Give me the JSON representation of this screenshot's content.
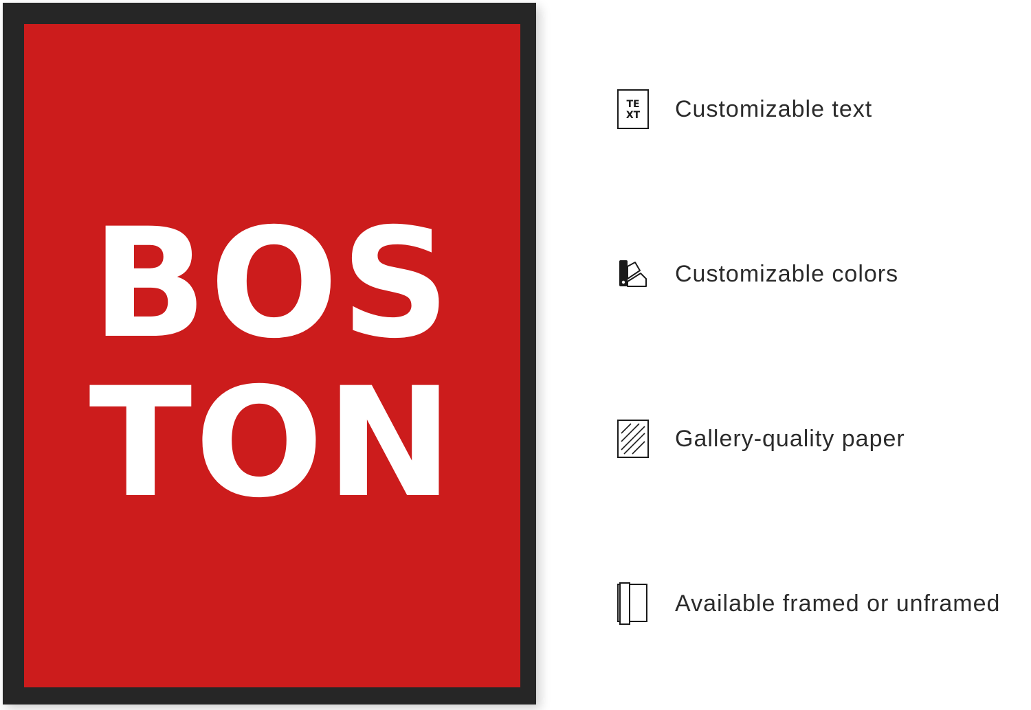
{
  "poster": {
    "line1": "BOS",
    "line2": "TON",
    "background_color": "#cc1c1c",
    "text_color": "#ffffff",
    "frame_color": "#262626"
  },
  "features": [
    {
      "icon": "text-icon",
      "icon_text": "TE\nXT",
      "label": "Customizable text"
    },
    {
      "icon": "color-swatch-icon",
      "label": "Customizable colors"
    },
    {
      "icon": "paper-hatch-icon",
      "label": "Gallery-quality paper"
    },
    {
      "icon": "frame-icon",
      "label": "Available framed or unframed"
    }
  ]
}
